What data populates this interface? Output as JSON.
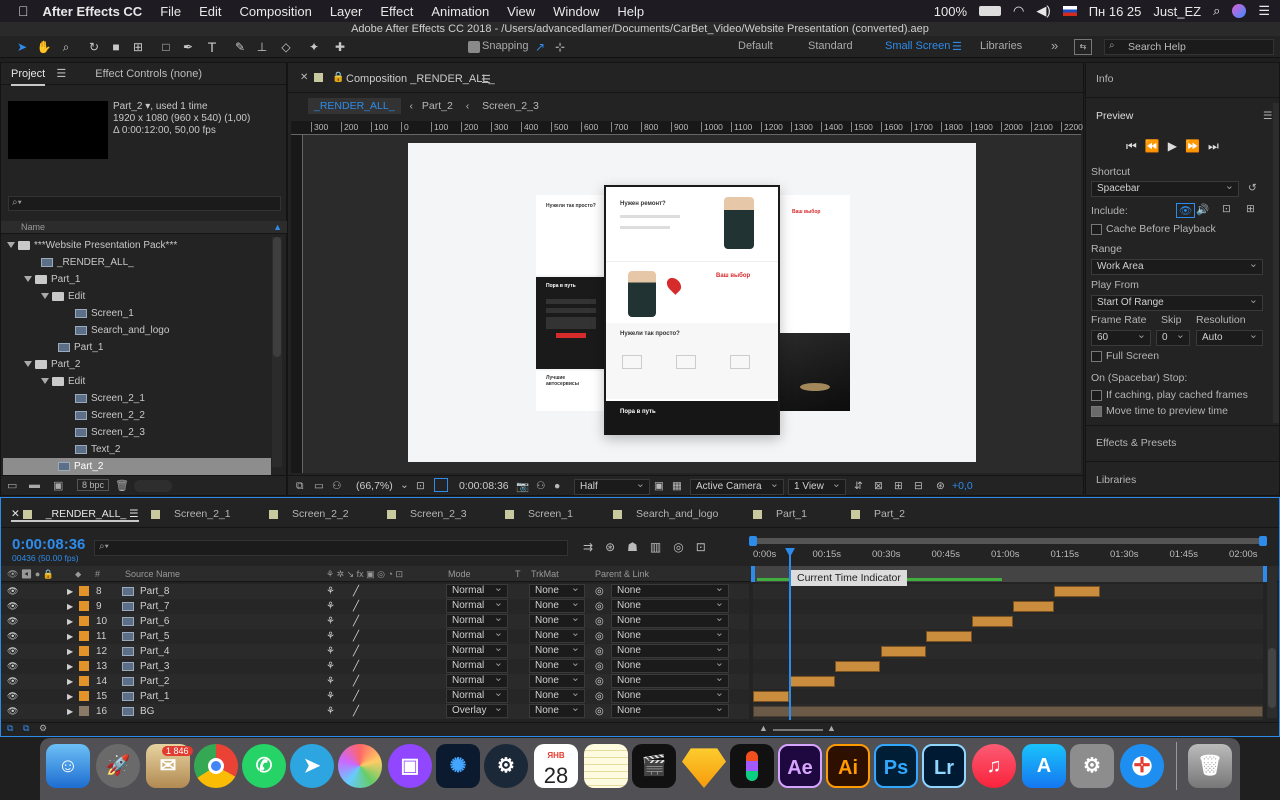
{
  "menubar": {
    "app": "After Effects CC",
    "items": [
      "File",
      "Edit",
      "Composition",
      "Layer",
      "Effect",
      "Animation",
      "View",
      "Window",
      "Help"
    ],
    "battery": "100%",
    "clock": "Пн 16 25",
    "user": "Just_EZ"
  },
  "window_title": "Adobe After Effects CC 2018 - /Users/advancedlamer/Documents/CarBet_Video/Website Presentation (converted).aep",
  "toolbar": {
    "snapping": "Snapping",
    "workspaces": [
      "Default",
      "Standard",
      "Small Screen",
      "Libraries"
    ],
    "active_workspace": "Small Screen",
    "search_placeholder": "Search Help"
  },
  "project_panel": {
    "tab_project": "Project",
    "tab_effects": "Effect Controls (none)",
    "preview_name": "Part_2",
    "preview_used": ", used 1 time",
    "preview_res": "1920 x 1080  (960 x 540) (1,00)",
    "preview_dur": "Δ 0:00:12:00, 50,00 fps",
    "search_placeholder": "",
    "col_name": "Name",
    "bpc": "8 bpc",
    "items": [
      {
        "label": "***Website Presentation Pack***",
        "type": "folder",
        "indent": 0,
        "expanded": true
      },
      {
        "label": "_RENDER_ALL_",
        "type": "comp",
        "indent": 2
      },
      {
        "label": "Part_1",
        "type": "folder",
        "indent": 1,
        "expanded": true
      },
      {
        "label": "Edit",
        "type": "folder",
        "indent": 2,
        "expanded": true
      },
      {
        "label": "Screen_1",
        "type": "comp",
        "indent": 4
      },
      {
        "label": "Search_and_logo",
        "type": "comp",
        "indent": 4
      },
      {
        "label": "Part_1",
        "type": "comp",
        "indent": 3
      },
      {
        "label": "Part_2",
        "type": "folder",
        "indent": 1,
        "expanded": true
      },
      {
        "label": "Edit",
        "type": "folder",
        "indent": 2,
        "expanded": true
      },
      {
        "label": "Screen_2_1",
        "type": "comp",
        "indent": 4
      },
      {
        "label": "Screen_2_2",
        "type": "comp",
        "indent": 4
      },
      {
        "label": "Screen_2_3",
        "type": "comp",
        "indent": 4
      },
      {
        "label": "Text_2",
        "type": "comp",
        "indent": 4
      },
      {
        "label": "Part_2",
        "type": "comp",
        "indent": 3,
        "selected": true
      }
    ]
  },
  "composition_panel": {
    "title": "Composition _RENDER_ALL_",
    "breadcrumbs": [
      "_RENDER_ALL_",
      "Part_2",
      "Screen_2_3"
    ],
    "ruler": [
      "300",
      "200",
      "100",
      "0",
      "100",
      "200",
      "300",
      "400",
      "500",
      "600",
      "700",
      "800",
      "900",
      "1000",
      "1100",
      "1200",
      "1300",
      "1400",
      "1500",
      "1600",
      "1700",
      "1800",
      "1900",
      "2000",
      "2100",
      "2200"
    ],
    "zoom": "(66,7%)",
    "timecode": "0:00:08:36",
    "resolution": "Half",
    "camera": "Active Camera",
    "views": "1 View",
    "exposure": "+0,0",
    "screen_texts": {
      "s1_title": "Нужен ремонт?",
      "s1_heading": "Нужели так просто?",
      "s1_btn": "Ваш выбор",
      "s2_title": "Нужели так просто?",
      "s3_title": "Ваш выбор",
      "dark_title": "Пора в путь",
      "dark2_title": "Пора в путь",
      "list_title": "Лучшие автосервисы"
    }
  },
  "right_panel": {
    "info": "Info",
    "preview": "Preview",
    "shortcut_label": "Shortcut",
    "shortcut_value": "Spacebar",
    "include_label": "Include:",
    "cache_label": "Cache Before Playback",
    "range_label": "Range",
    "range_value": "Work Area",
    "playfrom_label": "Play From",
    "playfrom_value": "Start Of Range",
    "framerate_label": "Frame Rate",
    "skip_label": "Skip",
    "resolution_label": "Resolution",
    "framerate_value": "60",
    "skip_value": "0",
    "resolution_value": "Auto",
    "fullscreen_label": "Full Screen",
    "stop_label": "On (Spacebar) Stop:",
    "cached_label": "If caching, play cached frames",
    "move_label": "Move time to preview time",
    "effects": "Effects & Presets",
    "libraries": "Libraries"
  },
  "timeline": {
    "tabs": [
      "_RENDER_ALL_",
      "Screen_2_1",
      "Screen_2_2",
      "Screen_2_3",
      "Screen_1",
      "Search_and_logo",
      "Part_1",
      "Part_2"
    ],
    "timecode": "0:00:08:36",
    "frames": "00436 (50.00 fps)",
    "col_source": "Source Name",
    "col_mode": "Mode",
    "col_t": "T",
    "col_trkmat": "TrkMat",
    "col_parent": "Parent & Link",
    "ruler": [
      "0:00s",
      "00:15s",
      "00:30s",
      "00:45s",
      "01:00s",
      "01:15s",
      "01:30s",
      "01:45s",
      "02:00s"
    ],
    "tooltip": "Current Time Indicator",
    "layers": [
      {
        "num": "8",
        "name": "Part_8",
        "mode": "Normal",
        "trkmat": "None",
        "parent": "None",
        "start": 0.59,
        "end": 0.68
      },
      {
        "num": "9",
        "name": "Part_7",
        "mode": "Normal",
        "trkmat": "None",
        "parent": "None",
        "start": 0.51,
        "end": 0.59
      },
      {
        "num": "10",
        "name": "Part_6",
        "mode": "Normal",
        "trkmat": "None",
        "parent": "None",
        "start": 0.43,
        "end": 0.51
      },
      {
        "num": "11",
        "name": "Part_5",
        "mode": "Normal",
        "trkmat": "None",
        "parent": "None",
        "start": 0.34,
        "end": 0.43
      },
      {
        "num": "12",
        "name": "Part_4",
        "mode": "Normal",
        "trkmat": "None",
        "parent": "None",
        "start": 0.25,
        "end": 0.34
      },
      {
        "num": "13",
        "name": "Part_3",
        "mode": "Normal",
        "trkmat": "None",
        "parent": "None",
        "start": 0.16,
        "end": 0.25
      },
      {
        "num": "14",
        "name": "Part_2",
        "mode": "Normal",
        "trkmat": "None",
        "parent": "None",
        "start": 0.07,
        "end": 0.16
      },
      {
        "num": "15",
        "name": "Part_1",
        "mode": "Normal",
        "trkmat": "None",
        "parent": "None",
        "start": 0.0,
        "end": 0.07
      },
      {
        "num": "16",
        "name": "BG",
        "mode": "Overlay",
        "trkmat": "None",
        "parent": "None",
        "start": 0.0,
        "end": 1.0
      }
    ]
  },
  "dock": {
    "badge": "1 846",
    "calendar_month": "ЯНВ",
    "calendar_day": "28",
    "ae": "Ae",
    "ai": "Ai",
    "ps": "Ps",
    "lr": "Lr"
  },
  "colors": {
    "accent": "#2d8ceb",
    "layer_orange": "#e2942a",
    "bar": "#c98d3d"
  }
}
